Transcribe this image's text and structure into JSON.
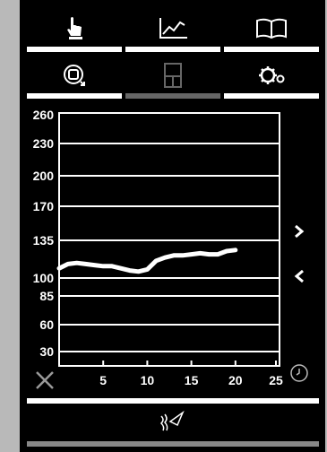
{
  "toolbar_top": {
    "tabs": [
      {
        "icon": "touch-hand-icon",
        "active": true
      },
      {
        "icon": "line-chart-icon",
        "active": true
      },
      {
        "icon": "book-icon",
        "active": true
      }
    ]
  },
  "toolbar_second": {
    "tabs": [
      {
        "icon": "cycle-device-icon",
        "active": true
      },
      {
        "icon": "layout-panels-icon",
        "active": false
      },
      {
        "icon": "gears-icon",
        "active": true
      }
    ]
  },
  "colors": {
    "background": "#000000",
    "grid": "#ffffff",
    "line": "#ffffff",
    "disabled": "#666666"
  },
  "chart_data": {
    "type": "line",
    "y_ticks": [
      "260",
      "230",
      "200",
      "170",
      "135",
      "100",
      "85",
      "60",
      "30"
    ],
    "x_ticks": [
      "5",
      "10",
      "15",
      "20",
      "25"
    ],
    "xlim": [
      0,
      25
    ],
    "ylim": [
      30,
      260
    ],
    "grid": true,
    "series": [
      {
        "x": [
          0,
          1,
          2,
          3,
          4,
          5,
          6,
          7,
          8,
          9,
          10,
          11,
          12,
          13,
          14,
          15,
          16,
          17,
          18,
          19,
          20
        ],
        "y": [
          109,
          113,
          114,
          113,
          112,
          111,
          111,
          109,
          107,
          106,
          108,
          116,
          119,
          121,
          121,
          122,
          123,
          122,
          122,
          125,
          126
        ]
      }
    ]
  },
  "controls": {
    "next_icon": "chevron-right-icon",
    "prev_icon": "chevron-left-icon",
    "close_icon": "close-icon",
    "clock_icon": "clock-icon",
    "bottom_icon": "signal-waves-icon"
  }
}
